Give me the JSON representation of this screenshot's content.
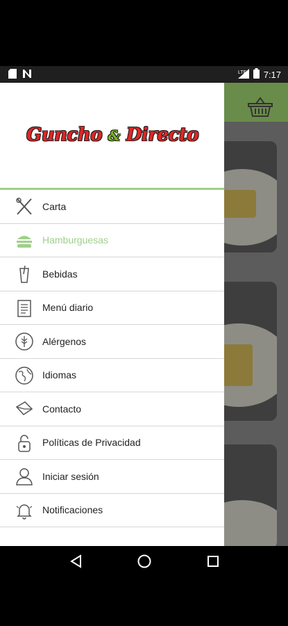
{
  "status": {
    "time": "7:17",
    "network": "LTE"
  },
  "app": {
    "logo_left": "Guncho",
    "logo_amp": "&",
    "logo_right": "Directo"
  },
  "menu": [
    {
      "label": "Carta",
      "icon": "fork-knife-icon",
      "active": false
    },
    {
      "label": "Hamburguesas",
      "icon": "burger-icon",
      "active": true
    },
    {
      "label": "Bebidas",
      "icon": "drink-icon",
      "active": false
    },
    {
      "label": "Menú diario",
      "icon": "notepad-icon",
      "active": false
    },
    {
      "label": "Alérgenos",
      "icon": "wheat-icon",
      "active": false
    },
    {
      "label": "Idiomas",
      "icon": "globe-icon",
      "active": false
    },
    {
      "label": "Contacto",
      "icon": "envelope-icon",
      "active": false
    },
    {
      "label": "Políticas de Privacidad",
      "icon": "lock-icon",
      "active": false
    },
    {
      "label": "Iniciar sesión",
      "icon": "user-icon",
      "active": false
    },
    {
      "label": "Notificaciones",
      "icon": "bell-icon",
      "active": false
    }
  ],
  "colors": {
    "accent": "#9fd08a",
    "header_bg": "#6a8c4a",
    "logo_red": "#e02525",
    "logo_green": "#7ab51d"
  }
}
